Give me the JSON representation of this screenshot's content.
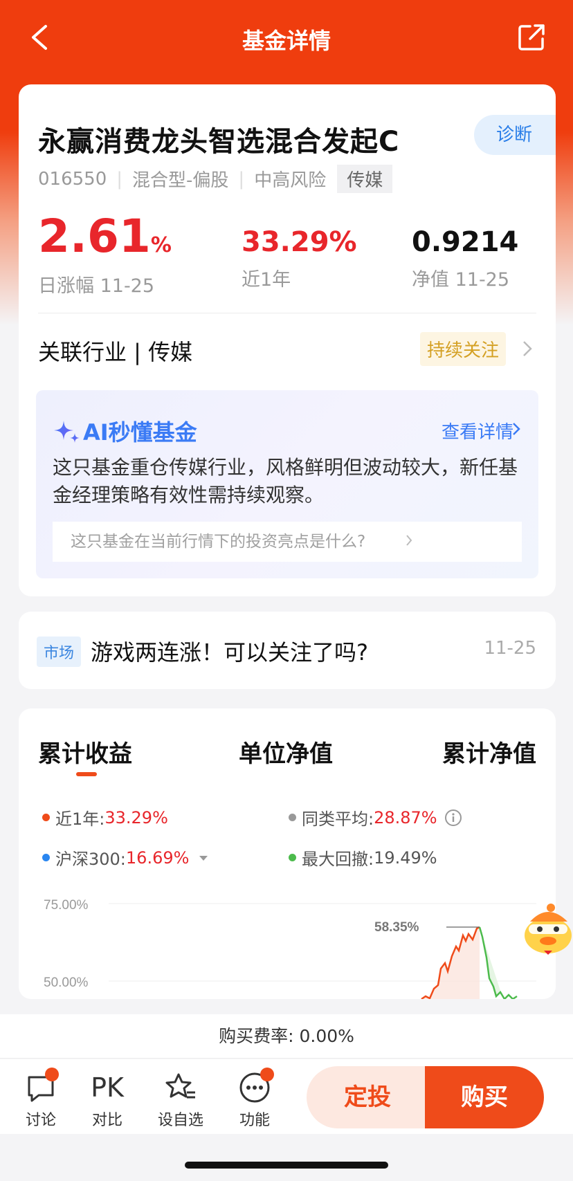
{
  "nav": {
    "title": "基金详情"
  },
  "fund": {
    "name": "永赢消费龙头智选混合发起C",
    "diagnose_label": "诊断",
    "code": "016550",
    "type": "混合型-偏股",
    "risk": "中高风险",
    "tag": "传媒",
    "daily_change": "2.61",
    "daily_change_unit": "%",
    "daily_change_label": "日涨幅 11-25",
    "year_return": "33.29%",
    "year_return_label": "近1年",
    "nav_value": "0.9214",
    "nav_label": "净值 11-25",
    "industry": "关联行业 | 传媒",
    "follow_label": "持续关注"
  },
  "ai": {
    "title": "AI秒懂基金",
    "link": "查看详情",
    "summary": "这只基金重仓传媒行业，风格鲜明但波动较大，新任基金经理策略有效性需持续观察。",
    "question": "这只基金在当前行情下的投资亮点是什么?"
  },
  "news": {
    "tag": "市场",
    "headline": "游戏两连涨！可以关注了吗?",
    "date": "11-25"
  },
  "tabs": [
    "累计收益",
    "单位净值",
    "累计净值"
  ],
  "legend": {
    "year_label": "近1年:",
    "year_value": "33.29%",
    "avg_label": "同类平均:",
    "avg_value": "28.87%",
    "hs300_label": "沪深300:",
    "hs300_value": "16.69%",
    "dd_label": "最大回撤:",
    "dd_value": "19.49%"
  },
  "colors": {
    "brand": "#ef3d0e",
    "up": "#e8262b",
    "series_fund": "#ef4b1a",
    "series_avg": "#999999",
    "series_hs300": "#2a86f0",
    "series_drawdown": "#4cbb4c"
  },
  "chart_data": {
    "type": "line",
    "y_tick_labels": [
      "75.00%",
      "50.00%"
    ],
    "peak_label": "58.35%",
    "peak_value": 58.35,
    "ylim": [
      40,
      75
    ]
  },
  "fee": "购买费率: 0.00%",
  "bottom": {
    "discuss": "讨论",
    "pk_text": "PK",
    "pk": "对比",
    "watch": "设自选",
    "func": "功能",
    "dingtou": "定投",
    "buy": "购买"
  }
}
